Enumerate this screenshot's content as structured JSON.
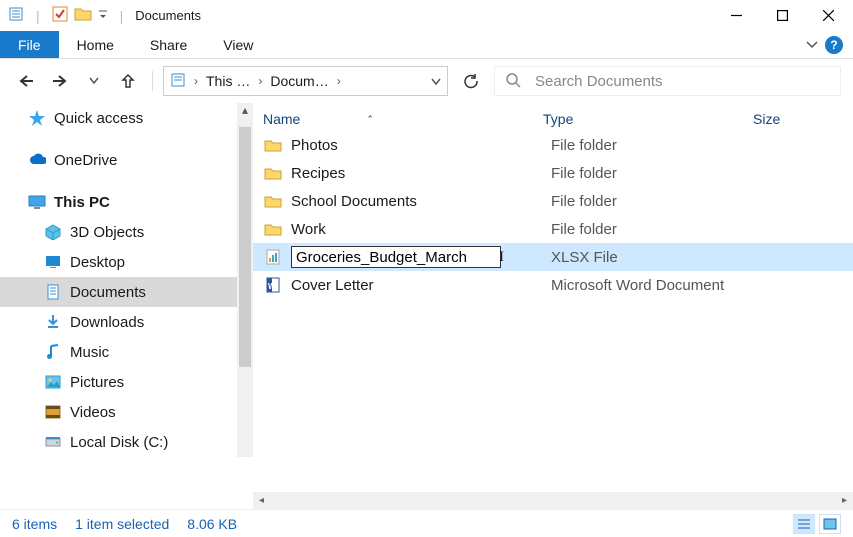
{
  "title": "Documents",
  "ribbon": {
    "file": "File",
    "tabs": [
      "Home",
      "Share",
      "View"
    ]
  },
  "breadcrumbs": [
    "This …",
    "Docum…"
  ],
  "search_placeholder": "Search Documents",
  "columns": {
    "name": "Name",
    "type": "Type",
    "size": "Size"
  },
  "nav": {
    "quick_access": "Quick access",
    "onedrive": "OneDrive",
    "thispc": "This PC",
    "thispc_children": [
      "3D Objects",
      "Desktop",
      "Documents",
      "Downloads",
      "Music",
      "Pictures",
      "Videos",
      "Local Disk (C:)"
    ]
  },
  "files": [
    {
      "name": "Photos",
      "type": "File folder",
      "kind": "folder"
    },
    {
      "name": "Recipes",
      "type": "File folder",
      "kind": "folder"
    },
    {
      "name": "School Documents",
      "type": "File folder",
      "kind": "folder"
    },
    {
      "name": "Work",
      "type": "File folder",
      "kind": "folder"
    },
    {
      "name": "Groceries_Budget_March",
      "type": "XLSX File",
      "kind": "xlsx",
      "selected": true,
      "renaming": true
    },
    {
      "name": "Cover Letter",
      "type": "Microsoft Word Document",
      "kind": "docx"
    }
  ],
  "status": {
    "count": "6 items",
    "selected": "1 item selected",
    "size": "8.06 KB"
  }
}
